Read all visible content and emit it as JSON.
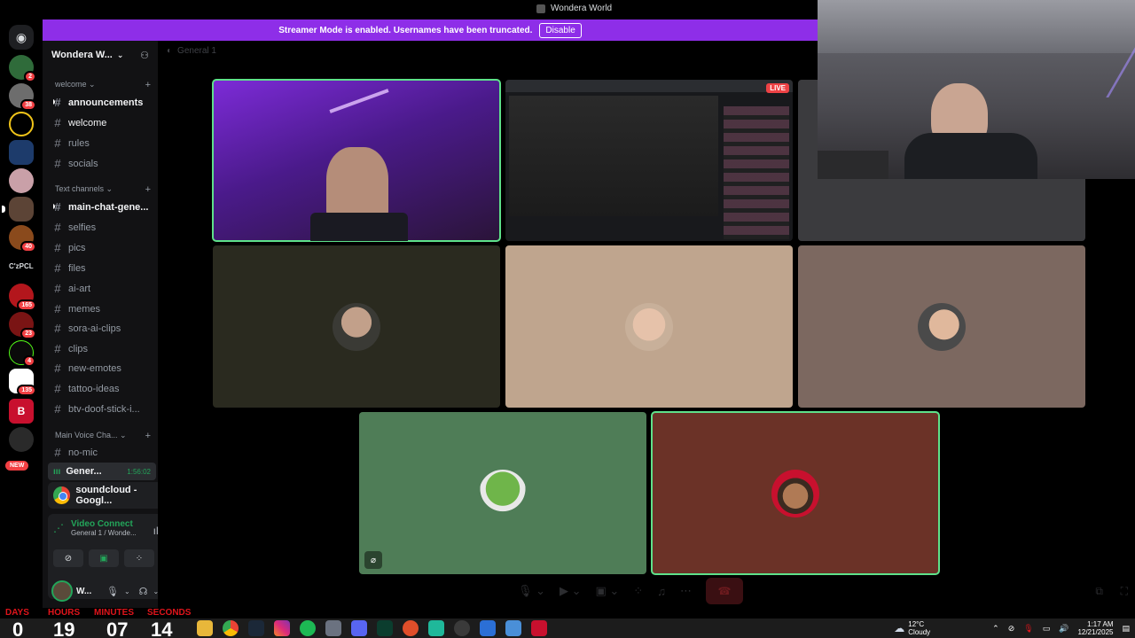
{
  "window": {
    "title": "Wondera World"
  },
  "banner": {
    "text": "Streamer Mode is enabled. Usernames have been truncated.",
    "disable_label": "Disable"
  },
  "rail": {
    "badges": [
      "2",
      "38",
      "40",
      "165",
      "23",
      "4",
      "135"
    ],
    "tagline": "C'zPCL",
    "new_label": "NEW"
  },
  "server": {
    "name": "Wondera W..."
  },
  "categories": {
    "welcome": "welcome",
    "text": "Text channels",
    "voice": "Main Voice Cha..."
  },
  "channels": {
    "announcements": "announcements",
    "welcome": "welcome",
    "rules": "rules",
    "socials": "socials",
    "main_chat": "main-chat-gene...",
    "selfies": "selfies",
    "pics": "pics",
    "files": "files",
    "ai_art": "ai-art",
    "memes": "memes",
    "sora": "sora-ai-clips",
    "clips": "clips",
    "new_emotes": "new-emotes",
    "tattoo": "tattoo-ideas",
    "btv": "btv-doof-stick-i...",
    "no_mic": "no-mic"
  },
  "voice": {
    "channel": "Gener...",
    "timer": "1:56:02"
  },
  "activity": {
    "label": "soundcloud - Googl..."
  },
  "vc": {
    "status": "Video Connect",
    "location": "General 1 / Wonde..."
  },
  "user": {
    "name": "W..."
  },
  "main": {
    "header": "General 1"
  },
  "stream": {
    "live_label": "LIVE"
  },
  "countdown": {
    "labels": [
      "DAYS",
      "HOURS",
      "MINUTES",
      "SECONDS"
    ],
    "values": [
      "0",
      "19",
      "07",
      "14"
    ]
  },
  "tray": {
    "temp": "12°C",
    "condition": "Cloudy",
    "time": "1:17 AM",
    "date": "12/21/2025"
  },
  "colors": {
    "banner": "#8e2ee8",
    "speaking": "#5ee18a",
    "tile_dark": "#2a2a1f",
    "tile_beige": "#bfa58e",
    "tile_taupe": "#7c6860",
    "tile_green": "#4f7d57",
    "tile_rust": "#6b3227"
  }
}
